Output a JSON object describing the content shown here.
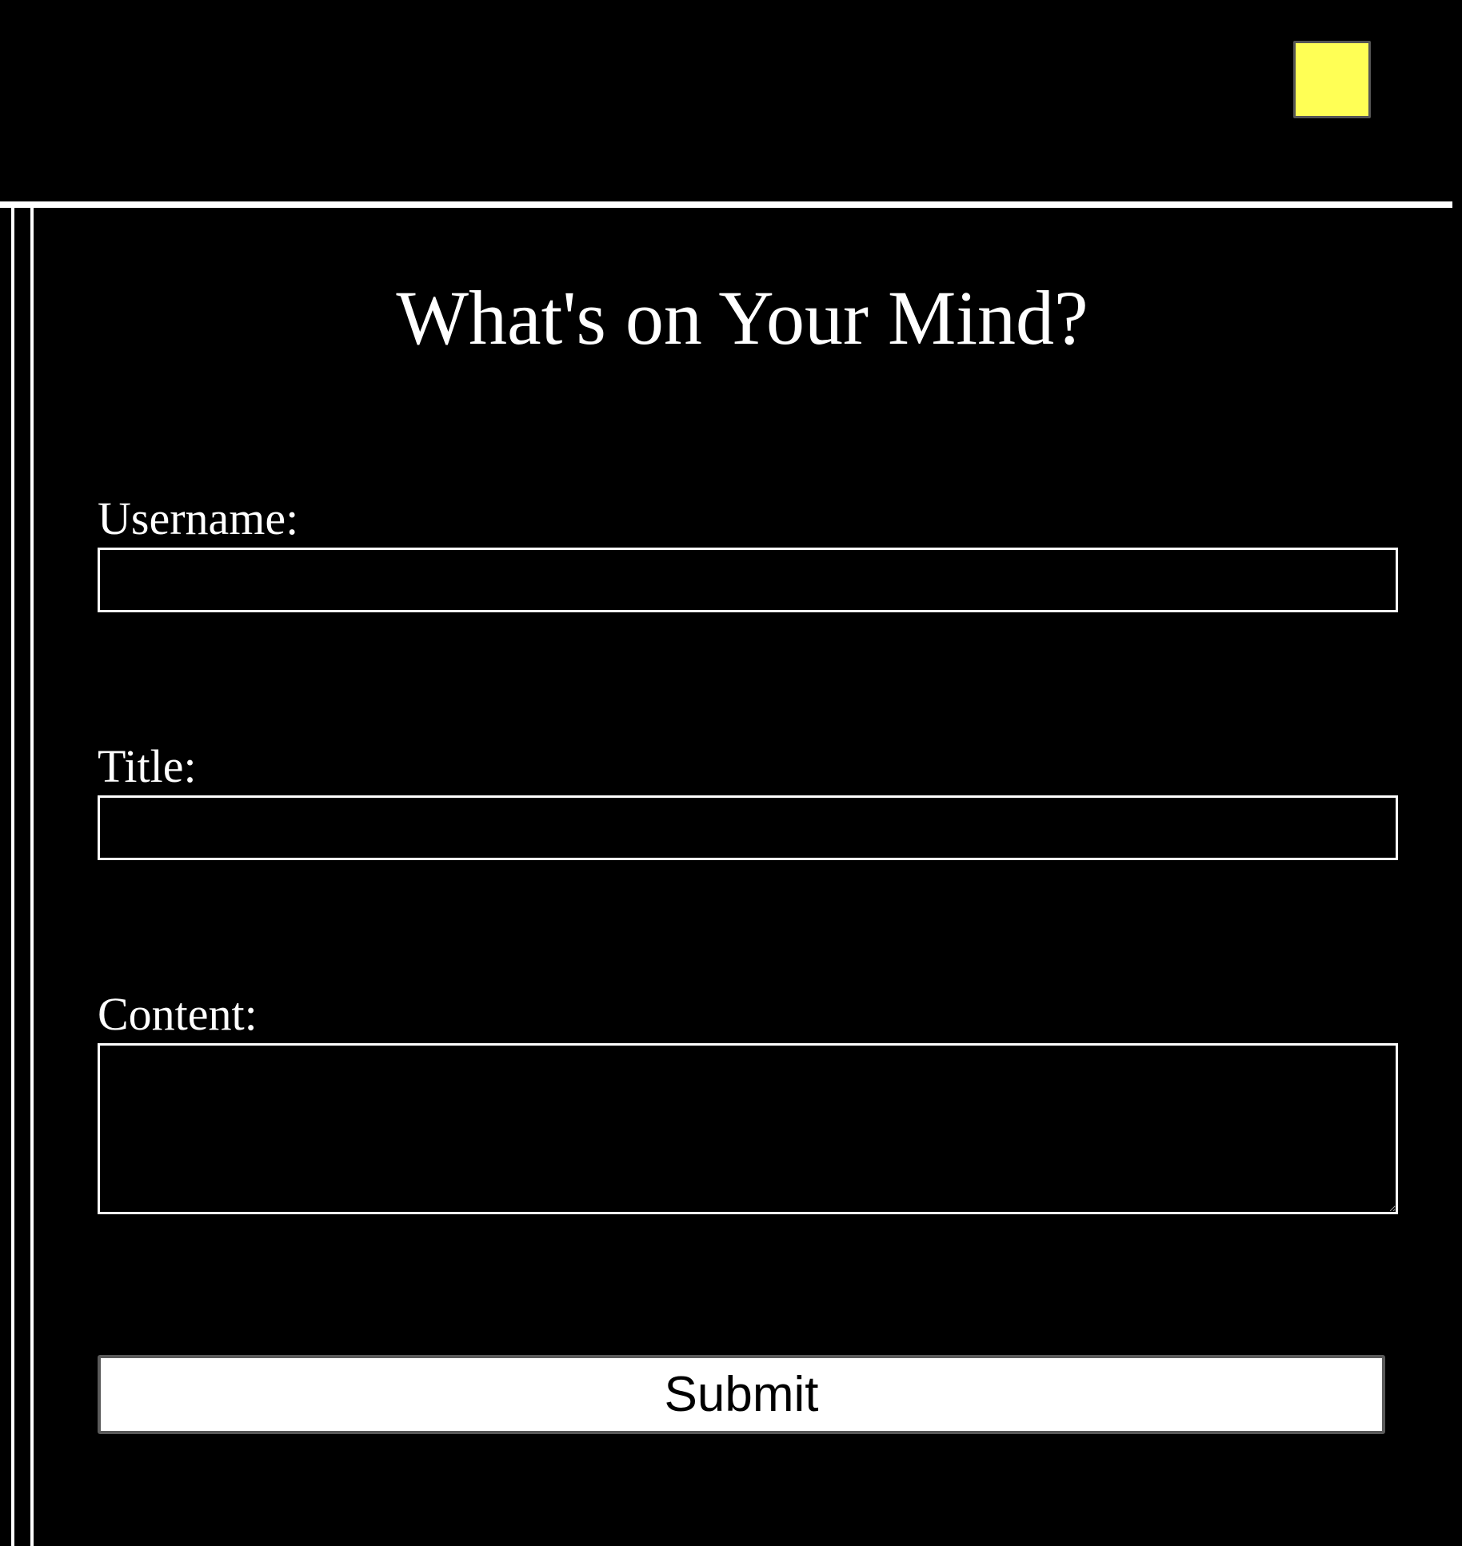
{
  "header": {
    "theme_toggle_color": "#ffff55"
  },
  "main": {
    "title": "What's on Your Mind?"
  },
  "form": {
    "username": {
      "label": "Username:",
      "value": "",
      "placeholder": ""
    },
    "title": {
      "label": "Title:",
      "value": "",
      "placeholder": ""
    },
    "content": {
      "label": "Content:",
      "value": "",
      "placeholder": ""
    },
    "submit_label": "Submit"
  },
  "colors": {
    "background": "#000000",
    "foreground": "#ffffff",
    "accent": "#ffff55"
  }
}
